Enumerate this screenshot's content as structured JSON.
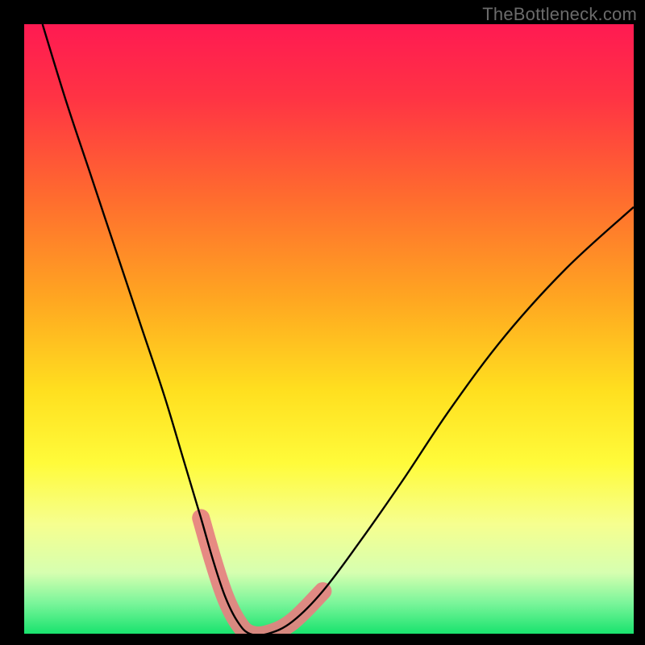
{
  "watermark": "TheBottleneck.com",
  "chart_data": {
    "type": "line",
    "title": "",
    "subtitle": "",
    "xlabel": "",
    "ylabel": "",
    "xlim": [
      0,
      100
    ],
    "ylim": [
      0,
      100
    ],
    "grid": false,
    "axes_visible": false,
    "legend": false,
    "background": {
      "type": "vertical-gradient",
      "stops": [
        {
          "pos": 0.0,
          "color": "#ff1a52"
        },
        {
          "pos": 0.12,
          "color": "#ff3344"
        },
        {
          "pos": 0.28,
          "color": "#ff6a2f"
        },
        {
          "pos": 0.45,
          "color": "#ffa621"
        },
        {
          "pos": 0.6,
          "color": "#ffdf1f"
        },
        {
          "pos": 0.72,
          "color": "#fffb3a"
        },
        {
          "pos": 0.82,
          "color": "#f6ff8f"
        },
        {
          "pos": 0.9,
          "color": "#d6ffb0"
        },
        {
          "pos": 0.95,
          "color": "#7af59a"
        },
        {
          "pos": 1.0,
          "color": "#19e36e"
        }
      ]
    },
    "series": [
      {
        "name": "bottleneck-curve",
        "color": "#000000",
        "x": [
          3,
          7,
          11,
          15,
          19,
          23,
          26,
          29,
          31,
          33,
          35,
          37,
          40,
          44,
          49,
          55,
          62,
          70,
          79,
          89,
          100
        ],
        "y": [
          100,
          87,
          75,
          63,
          51,
          39,
          29,
          19,
          12,
          6,
          2,
          0,
          0,
          2,
          7,
          15,
          25,
          37,
          49,
          60,
          70
        ]
      }
    ],
    "highlight_region": {
      "name": "optimal-zone-marker",
      "color": "#e68080",
      "x": [
        29,
        31,
        33,
        35,
        37,
        40,
        44,
        49
      ],
      "y": [
        19,
        12,
        6,
        2,
        0,
        0,
        2,
        7
      ]
    }
  }
}
